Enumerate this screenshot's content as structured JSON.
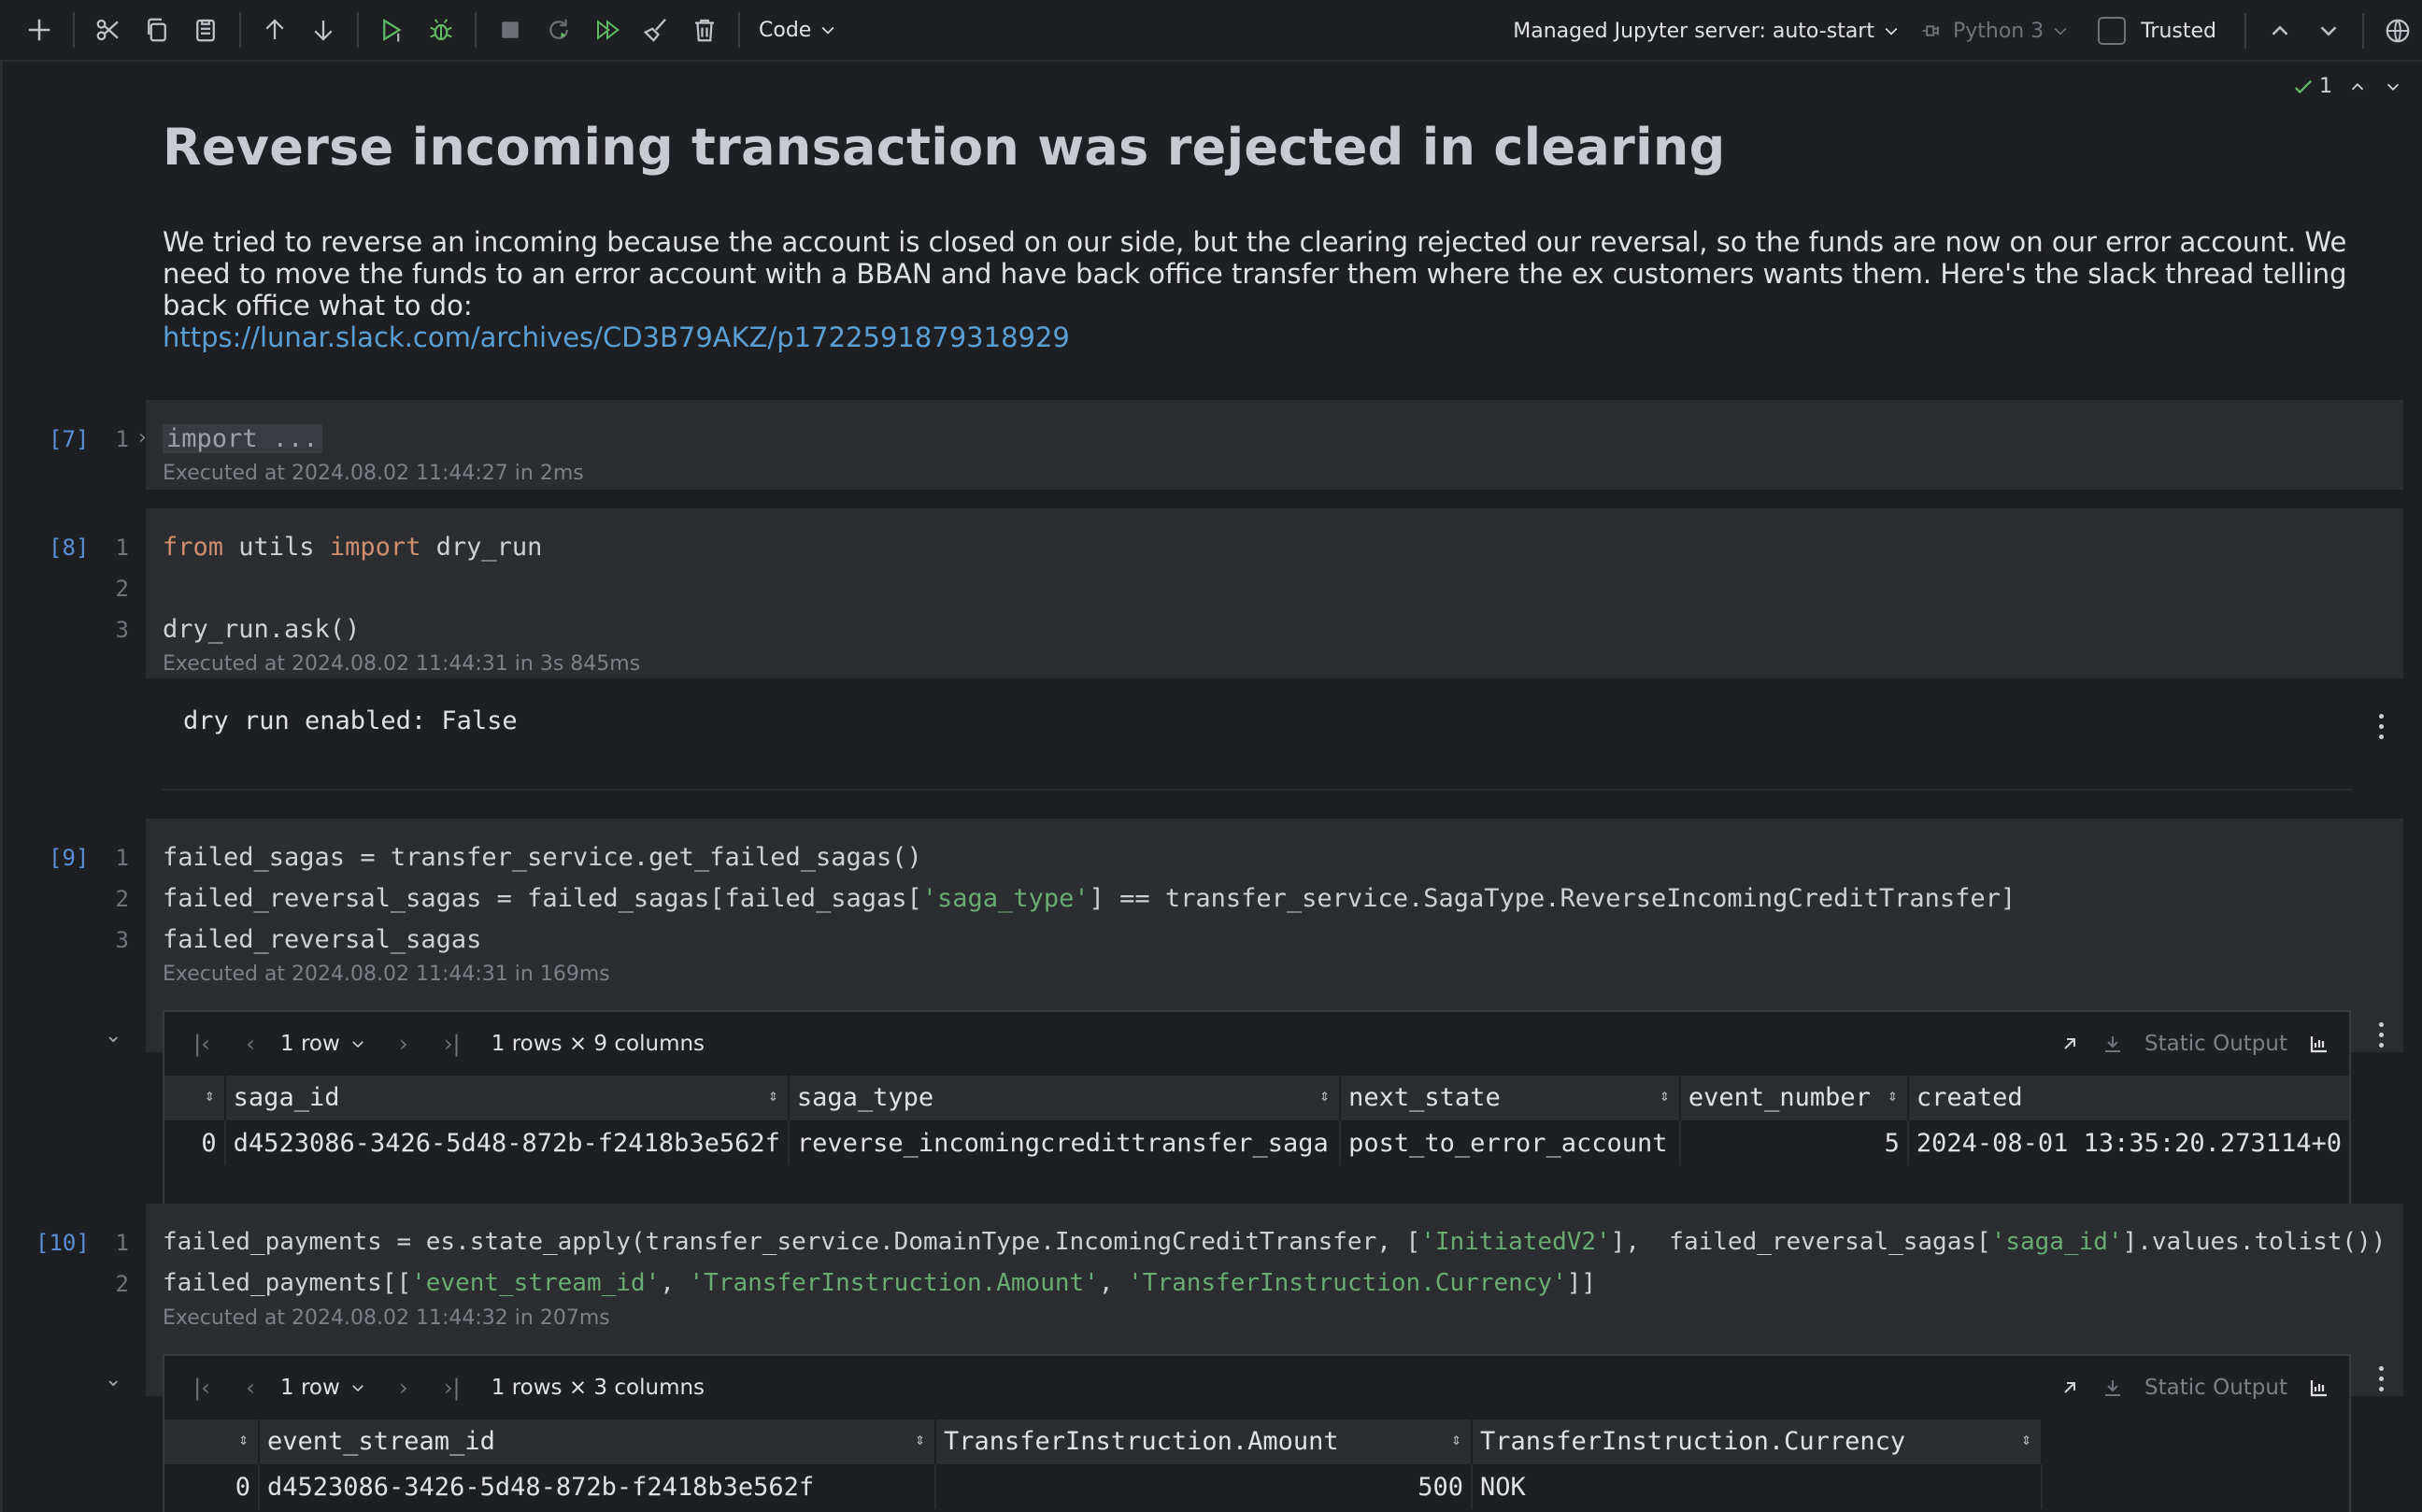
{
  "toolbar": {
    "kernel_type": "Code",
    "server": "Managed Jupyter server: auto-start",
    "python": "Python 3",
    "trusted": "Trusted"
  },
  "inspections": {
    "count": "1"
  },
  "markdown": {
    "title": "Reverse incoming transaction was rejected in clearing",
    "paragraph": "We tried to reverse an incoming because the account is closed on our side, but the clearing rejected our reversal, so the funds are now on our error account. We need to move the funds to an error account with a BBAN and have back office transfer them where the ex customers wants them. Here's the slack thread telling back office what to do:",
    "link": "https://lunar.slack.com/archives/CD3B79AKZ/p1722591879318929"
  },
  "cells": [
    {
      "count": "[7]",
      "lines": [
        {
          "n": "1",
          "text": "import ..."
        }
      ],
      "meta": "Executed at 2024.08.02 11:44:27 in 2ms"
    },
    {
      "count": "[8]",
      "lines": [
        {
          "n": "1",
          "t1": "from",
          "t2": " utils ",
          "t3": "import",
          "t4": " dry_run"
        },
        {
          "n": "2"
        },
        {
          "n": "3",
          "text": "dry_run.ask()"
        }
      ],
      "meta": "Executed at 2024.08.02 11:44:31 in 3s 845ms",
      "output": "dry run enabled: False"
    },
    {
      "count": "[9]",
      "lines": [
        {
          "n": "1",
          "text": "failed_sagas = transfer_service.get_failed_sagas()"
        },
        {
          "n": "2",
          "a": "failed_reversal_sagas = failed_sagas[failed_sagas[",
          "s": "'saga_type'",
          "b": "] == transfer_service.SagaType.ReverseIncomingCreditTransfer]"
        },
        {
          "n": "3",
          "text": "failed_reversal_sagas"
        }
      ],
      "meta": "Executed at 2024.08.02 11:44:31 in 169ms",
      "df": {
        "rows_select": "1 row",
        "shape": "1 rows × 9 columns",
        "static": "Static Output",
        "columns": [
          "saga_id",
          "saga_type",
          "next_state",
          "event_number",
          "created"
        ],
        "rows": [
          {
            "idx": "0",
            "cells": [
              "d4523086-3426-5d48-872b-f2418b3e562f",
              "reverse_incomingcredittransfer_saga",
              "post_to_error_account",
              "5",
              "2024-08-01 13:35:20.273114+0"
            ]
          }
        ]
      }
    },
    {
      "count": "[10]",
      "lines": [
        {
          "n": "1",
          "a": "failed_payments = es.state_apply(transfer_service.DomainType.IncomingCreditTransfer, [",
          "s": "'InitiatedV2'",
          "b": "],  failed_reversal_sagas[",
          "s2": "'saga_id'",
          "c": "].values.tolist())"
        },
        {
          "n": "2",
          "a": "failed_payments[[",
          "s": "'event_stream_id'",
          "b": ", ",
          "s2": "'TransferInstruction.Amount'",
          "c": ", ",
          "s3": "'TransferInstruction.Currency'",
          "d": "]]"
        }
      ],
      "meta": "Executed at 2024.08.02 11:44:32 in 207ms",
      "df": {
        "rows_select": "1 row",
        "shape": "1 rows × 3 columns",
        "static": "Static Output",
        "columns": [
          "event_stream_id",
          "TransferInstruction.Amount",
          "TransferInstruction.Currency"
        ],
        "rows": [
          {
            "idx": "0",
            "cells": [
              "d4523086-3426-5d48-872b-f2418b3e562f",
              "500",
              "NOK"
            ]
          }
        ]
      }
    }
  ]
}
